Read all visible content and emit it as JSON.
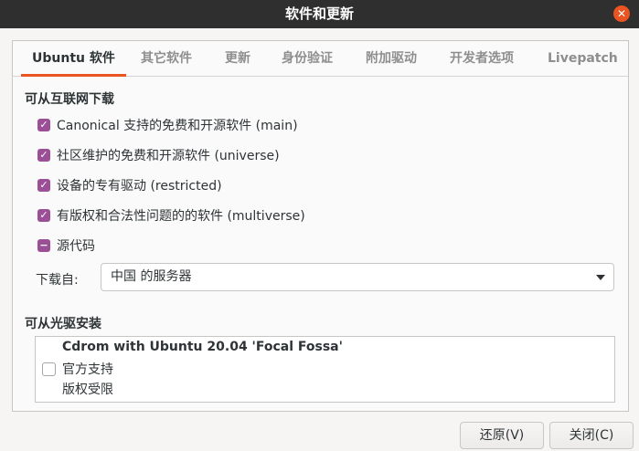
{
  "window": {
    "title": "软件和更新",
    "close_glyph": "✕"
  },
  "tabs": [
    {
      "label": "Ubuntu 软件",
      "active": true
    },
    {
      "label": "其它软件"
    },
    {
      "label": "更新"
    },
    {
      "label": "身份验证"
    },
    {
      "label": "附加驱动"
    },
    {
      "label": "开发者选项"
    },
    {
      "label": "Livepatch"
    }
  ],
  "internet": {
    "heading": "可从互联网下载",
    "options": [
      {
        "label": "Canonical 支持的免费和开源软件 (main)",
        "state": "checked"
      },
      {
        "label": "社区维护的免费和开源软件 (universe)",
        "state": "checked"
      },
      {
        "label": "设备的专有驱动 (restricted)",
        "state": "checked"
      },
      {
        "label": "有版权和合法性问题的的软件 (multiverse)",
        "state": "checked"
      },
      {
        "label": "源代码",
        "state": "mixed"
      }
    ],
    "download_from_label": "下载自:",
    "download_from_value": "中国 的服务器"
  },
  "cdrom": {
    "heading": "可从光驱安装",
    "title": "Cdrom with Ubuntu 20.04 'Focal Fossa'",
    "line2": "官方支持",
    "line3": "版权受限",
    "checked": false
  },
  "buttons": {
    "revert": "还原(V)",
    "close": "关闭(C)"
  },
  "colors": {
    "accent": "#e95420",
    "checkbox": "#9b4f96",
    "titlebar": "#2f2f2f"
  }
}
